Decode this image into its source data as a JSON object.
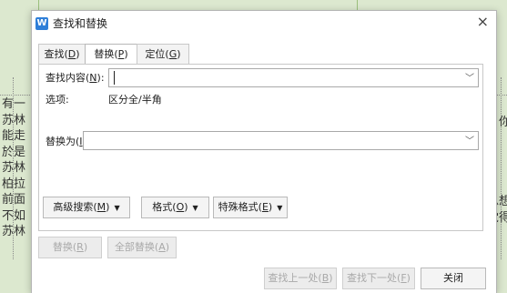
{
  "background_doc": {
    "left_column": [
      "有一",
      "苏林",
      "能走",
      "於是",
      "苏林",
      "柏拉",
      "前面",
      "不如",
      "苏林"
    ],
    "right_column": [
      "：你",
      "总想",
      "觉得"
    ]
  },
  "dialog": {
    "title": "查找和替换",
    "close": "×",
    "tabs": [
      {
        "label": "查找(",
        "key": "D",
        "suffix": ")"
      },
      {
        "label": "替换(",
        "key": "P",
        "suffix": ")"
      },
      {
        "label": "定位(",
        "key": "G",
        "suffix": ")"
      }
    ],
    "find": {
      "label_pre": "查找内容(",
      "label_key": "N",
      "label_post": "):",
      "value": ""
    },
    "options": {
      "label": "选项:",
      "value": "区分全/半角"
    },
    "replace": {
      "label_pre": "替换为(",
      "label_key": "I",
      "label_post": "):",
      "value": ""
    },
    "option_buttons": [
      {
        "pre": "高级搜索(",
        "key": "M",
        "post": ")",
        "glyph": "▼"
      },
      {
        "pre": "格式(",
        "key": "O",
        "post": ")",
        "glyph": "▼"
      },
      {
        "pre": "特殊格式(",
        "key": "E",
        "post": ")",
        "glyph": "▼"
      }
    ],
    "action_buttons": [
      {
        "pre": "替换(",
        "key": "R",
        "post": ")"
      },
      {
        "pre": "全部替换(",
        "key": "A",
        "post": ")"
      }
    ],
    "footer_buttons": [
      {
        "pre": "查找上一处(",
        "key": "B",
        "post": ")"
      },
      {
        "pre": "查找下一处(",
        "key": "F",
        "post": ")"
      },
      {
        "pre": "关闭",
        "key": "",
        "post": ""
      }
    ]
  }
}
